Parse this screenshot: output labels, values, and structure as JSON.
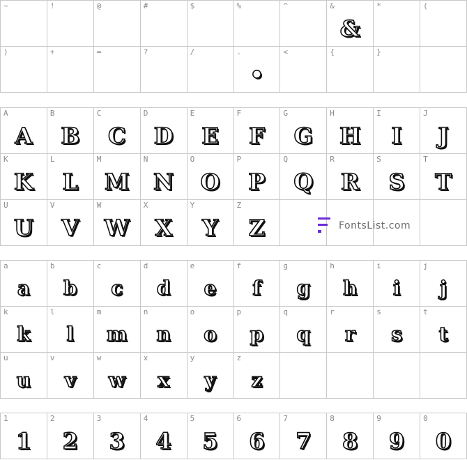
{
  "sections": [
    {
      "id": "symbols",
      "cells": [
        {
          "label": "~",
          "glyph": ""
        },
        {
          "label": "!",
          "glyph": ""
        },
        {
          "label": "@",
          "glyph": ""
        },
        {
          "label": "#",
          "glyph": ""
        },
        {
          "label": "$",
          "glyph": ""
        },
        {
          "label": "%",
          "glyph": ""
        },
        {
          "label": "^",
          "glyph": ""
        },
        {
          "label": "&",
          "glyph": "&"
        },
        {
          "label": "*",
          "glyph": ""
        },
        {
          "label": "(",
          "glyph": ""
        },
        {
          "label": ")",
          "glyph": ""
        },
        {
          "label": "+",
          "glyph": ""
        },
        {
          "label": "=",
          "glyph": ""
        },
        {
          "label": "?",
          "glyph": ""
        },
        {
          "label": "/",
          "glyph": ""
        },
        {
          "label": ".",
          "glyph": "•"
        },
        {
          "label": "<",
          "glyph": ""
        },
        {
          "label": "{",
          "glyph": ""
        },
        {
          "label": "}",
          "glyph": ""
        },
        {
          "label": "",
          "glyph": ""
        }
      ]
    },
    {
      "id": "uppercase",
      "cells": [
        {
          "label": "A",
          "glyph": "A"
        },
        {
          "label": "B",
          "glyph": "B"
        },
        {
          "label": "C",
          "glyph": "C"
        },
        {
          "label": "D",
          "glyph": "D"
        },
        {
          "label": "E",
          "glyph": "E"
        },
        {
          "label": "F",
          "glyph": "F"
        },
        {
          "label": "G",
          "glyph": "G"
        },
        {
          "label": "H",
          "glyph": "H"
        },
        {
          "label": "I",
          "glyph": "I"
        },
        {
          "label": "J",
          "glyph": "J"
        },
        {
          "label": "K",
          "glyph": "K"
        },
        {
          "label": "L",
          "glyph": "L"
        },
        {
          "label": "M",
          "glyph": "M"
        },
        {
          "label": "N",
          "glyph": "N"
        },
        {
          "label": "O",
          "glyph": "O"
        },
        {
          "label": "P",
          "glyph": "P"
        },
        {
          "label": "Q",
          "glyph": "Q"
        },
        {
          "label": "R",
          "glyph": "R"
        },
        {
          "label": "S",
          "glyph": "S"
        },
        {
          "label": "T",
          "glyph": "T"
        },
        {
          "label": "U",
          "glyph": "U"
        },
        {
          "label": "V",
          "glyph": "V"
        },
        {
          "label": "W",
          "glyph": "W"
        },
        {
          "label": "X",
          "glyph": "X"
        },
        {
          "label": "Y",
          "glyph": "Y"
        },
        {
          "label": "Z",
          "glyph": "Z"
        }
      ]
    },
    {
      "id": "lowercase",
      "cells": [
        {
          "label": "a",
          "glyph": "a"
        },
        {
          "label": "b",
          "glyph": "b"
        },
        {
          "label": "c",
          "glyph": "c"
        },
        {
          "label": "d",
          "glyph": "d"
        },
        {
          "label": "e",
          "glyph": "e"
        },
        {
          "label": "f",
          "glyph": "f"
        },
        {
          "label": "g",
          "glyph": "g"
        },
        {
          "label": "h",
          "glyph": "h"
        },
        {
          "label": "i",
          "glyph": "i"
        },
        {
          "label": "j",
          "glyph": "j"
        },
        {
          "label": "k",
          "glyph": "k"
        },
        {
          "label": "l",
          "glyph": "l"
        },
        {
          "label": "m",
          "glyph": "m"
        },
        {
          "label": "n",
          "glyph": "n"
        },
        {
          "label": "o",
          "glyph": "o"
        },
        {
          "label": "p",
          "glyph": "p"
        },
        {
          "label": "q",
          "glyph": "q"
        },
        {
          "label": "r",
          "glyph": "r"
        },
        {
          "label": "s",
          "glyph": "s"
        },
        {
          "label": "t",
          "glyph": "t"
        },
        {
          "label": "u",
          "glyph": "u"
        },
        {
          "label": "v",
          "glyph": "v"
        },
        {
          "label": "w",
          "glyph": "w"
        },
        {
          "label": "x",
          "glyph": "x"
        },
        {
          "label": "y",
          "glyph": "y"
        },
        {
          "label": "z",
          "glyph": "z"
        }
      ]
    },
    {
      "id": "digits",
      "cells": [
        {
          "label": "1",
          "glyph": "1"
        },
        {
          "label": "2",
          "glyph": "2"
        },
        {
          "label": "3",
          "glyph": "3"
        },
        {
          "label": "4",
          "glyph": "4"
        },
        {
          "label": "5",
          "glyph": "5"
        },
        {
          "label": "6",
          "glyph": "6"
        },
        {
          "label": "7",
          "glyph": "7"
        },
        {
          "label": "8",
          "glyph": "8"
        },
        {
          "label": "9",
          "glyph": "9"
        },
        {
          "label": "0",
          "glyph": "0"
        }
      ]
    }
  ],
  "watermark": {
    "text": "FontsList.com",
    "icon": "fontslist-logo-icon",
    "accent": "#6c2bd9"
  }
}
